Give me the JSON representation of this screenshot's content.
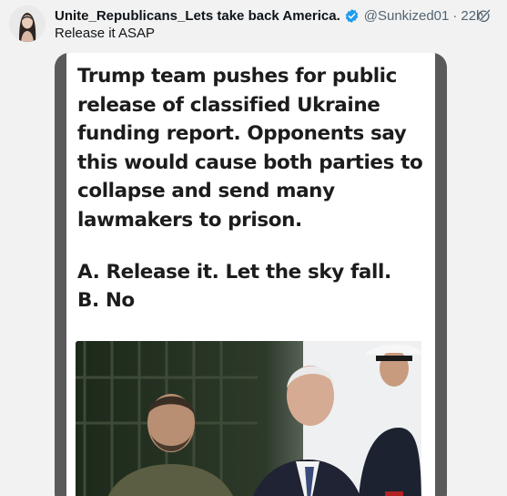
{
  "post": {
    "display_name": "Unite_Republicans_Lets take back America.",
    "handle": "@Sunkized01",
    "separator": "·",
    "time": "22h",
    "text": "Release it ASAP"
  },
  "media": {
    "headline": "Trump team pushes for public release of classified Ukraine funding report. Opponents say this would cause both parties to collapse and send many lawmakers to prison.",
    "option_a": "A. Release it. Let the sky fall.",
    "option_b": "B. No"
  },
  "colors": {
    "verified_badge": "#1d9bf0",
    "secondary_text": "#536471",
    "background": "#f2f2f2"
  },
  "icons": [
    "verified-badge-icon",
    "grok-icon"
  ]
}
